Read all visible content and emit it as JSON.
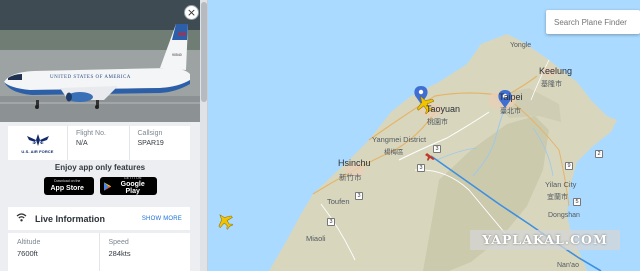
{
  "aircraft": {
    "callsign_label": "Callsign",
    "callsign_value": "SPAR19",
    "flight_label": "Flight No.",
    "flight_value": "N/A",
    "operator_logo_text": "U.S. AIR FORCE",
    "fuselage_text": "UNITED STATES OF AMERICA",
    "tail_code": "90540"
  },
  "promo": {
    "title": "Enjoy app only features",
    "appstore_small": "Download on the",
    "appstore_big": "App Store",
    "googleplay_small": "GET IT ON",
    "googleplay_big": "Google Play"
  },
  "live": {
    "title": "Live Information",
    "show_more": "SHOW MORE",
    "altitude_label": "Altitude",
    "altitude_value": "7600ft",
    "speed_label": "Speed",
    "speed_value": "284kts"
  },
  "map": {
    "search_placeholder": "Search Plane Finder",
    "labels": {
      "yongle": "Yongle",
      "keelung": "Keelung",
      "keelung_cn": "基隆市",
      "taoyuan": "Taoyuan",
      "taoyuan_cn": "桃園市",
      "taipei": "Taipei",
      "taipei_cn": "臺北市",
      "yangmei": "Yangmei District",
      "yangmei_cn": "楊梅區",
      "hsinchu": "Hsinchu",
      "hsinchu_cn": "新竹市",
      "yilan": "Yilan City",
      "yilan_cn": "宜蘭市",
      "toufen": "Toufen",
      "miaoli": "Miaoli",
      "dongshan": "Dongshan",
      "nanao": "Nan'ao"
    },
    "road_shields": [
      "3",
      "3",
      "3",
      "2",
      "9",
      "5",
      "3"
    ],
    "colors": {
      "sea": "#aadaff",
      "land": "#d8d7be",
      "highlight_track": "#3d8fe0",
      "marker": "#3f6fd2",
      "plane": "#f2c300"
    }
  },
  "watermark": "YAPLAKAL.COM"
}
